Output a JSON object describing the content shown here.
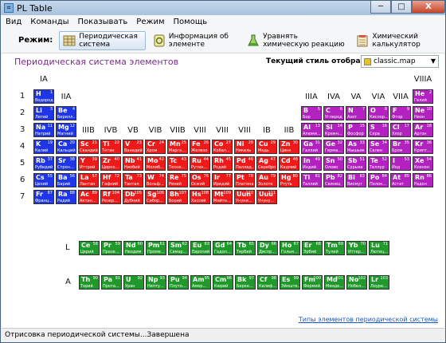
{
  "window": {
    "title": "PL Table",
    "minimize": "─",
    "maximize": "□",
    "close": "X"
  },
  "menu": [
    "Вид",
    "Команды",
    "Показывать",
    "Режим",
    "Помощь"
  ],
  "toolbar": {
    "mode_label": "Режим:",
    "items": [
      {
        "label": "Периодическая система",
        "active": true,
        "icon": "grid-icon"
      },
      {
        "label": "Информация об элементе",
        "active": false,
        "icon": "info-icon"
      },
      {
        "label": "Уравнять химическую реакцию",
        "active": false,
        "icon": "flask-icon"
      },
      {
        "label": "Химический калькулятор",
        "active": false,
        "icon": "calculator-icon"
      }
    ]
  },
  "page_title": "Периодическая система элементов",
  "style": {
    "label": "Текущий стиль отображения:",
    "value": "classic.map"
  },
  "groups": [
    "IA",
    "IIA",
    "IIIB",
    "IVB",
    "VB",
    "VIB",
    "VIIB",
    "VIII",
    "VIII",
    "VIII",
    "IB",
    "IIB",
    "IIIA",
    "IVA",
    "VA",
    "VIA",
    "VIIA",
    "VIIIA"
  ],
  "periods": [
    "1",
    "2",
    "3",
    "4",
    "5",
    "6",
    "7"
  ],
  "series_labels": {
    "lanthanides": "L",
    "actinides": "A"
  },
  "colors": {
    "s": "#1f36e8",
    "transition": "#ee1a1a",
    "p": "#b321c1",
    "f": "#1f9a2a"
  },
  "elements": [
    {
      "s": "H",
      "n": "1",
      "nm": "Водород",
      "p": 1,
      "g": 1,
      "c": "s"
    },
    {
      "s": "He",
      "n": "2",
      "nm": "Гелий",
      "p": 1,
      "g": 18,
      "c": "p"
    },
    {
      "s": "Li",
      "n": "3",
      "nm": "Литий",
      "p": 2,
      "g": 1,
      "c": "s"
    },
    {
      "s": "Be",
      "n": "4",
      "nm": "Берилл...",
      "p": 2,
      "g": 2,
      "c": "s"
    },
    {
      "s": "B",
      "n": "5",
      "nm": "Бор",
      "p": 2,
      "g": 13,
      "c": "p"
    },
    {
      "s": "C",
      "n": "6",
      "nm": "Углерод",
      "p": 2,
      "g": 14,
      "c": "p"
    },
    {
      "s": "N",
      "n": "7",
      "nm": "Азот",
      "p": 2,
      "g": 15,
      "c": "p"
    },
    {
      "s": "O",
      "n": "8",
      "nm": "Кислор...",
      "p": 2,
      "g": 16,
      "c": "p"
    },
    {
      "s": "F",
      "n": "9",
      "nm": "Фтор",
      "p": 2,
      "g": 17,
      "c": "p"
    },
    {
      "s": "Ne",
      "n": "10",
      "nm": "Неон",
      "p": 2,
      "g": 18,
      "c": "p"
    },
    {
      "s": "Na",
      "n": "11",
      "nm": "Натрий",
      "p": 3,
      "g": 1,
      "c": "s"
    },
    {
      "s": "Mg",
      "n": "12",
      "nm": "Магний",
      "p": 3,
      "g": 2,
      "c": "s"
    },
    {
      "s": "Al",
      "n": "13",
      "nm": "Алюми...",
      "p": 3,
      "g": 13,
      "c": "p"
    },
    {
      "s": "Si",
      "n": "14",
      "nm": "Кремн...",
      "p": 3,
      "g": 14,
      "c": "p"
    },
    {
      "s": "P",
      "n": "15",
      "nm": "Фосфор",
      "p": 3,
      "g": 15,
      "c": "p"
    },
    {
      "s": "S",
      "n": "16",
      "nm": "Сера",
      "p": 3,
      "g": 16,
      "c": "p"
    },
    {
      "s": "Cl",
      "n": "17",
      "nm": "Хлор",
      "p": 3,
      "g": 17,
      "c": "p"
    },
    {
      "s": "Ar",
      "n": "18",
      "nm": "Аргон",
      "p": 3,
      "g": 18,
      "c": "p"
    },
    {
      "s": "K",
      "n": "19",
      "nm": "Калий",
      "p": 4,
      "g": 1,
      "c": "s"
    },
    {
      "s": "Ca",
      "n": "20",
      "nm": "Кальций",
      "p": 4,
      "g": 2,
      "c": "s"
    },
    {
      "s": "Sc",
      "n": "21",
      "nm": "Скандий",
      "p": 4,
      "g": 3,
      "c": "t"
    },
    {
      "s": "Ti",
      "n": "22",
      "nm": "Титан",
      "p": 4,
      "g": 4,
      "c": "t"
    },
    {
      "s": "V",
      "n": "23",
      "nm": "Ванадий",
      "p": 4,
      "g": 5,
      "c": "t"
    },
    {
      "s": "Cr",
      "n": "24",
      "nm": "Хром",
      "p": 4,
      "g": 6,
      "c": "t"
    },
    {
      "s": "Mn",
      "n": "25",
      "nm": "Марга...",
      "p": 4,
      "g": 7,
      "c": "t"
    },
    {
      "s": "Fe",
      "n": "26",
      "nm": "Железо",
      "p": 4,
      "g": 8,
      "c": "t"
    },
    {
      "s": "Co",
      "n": "27",
      "nm": "Кобал...",
      "p": 4,
      "g": 9,
      "c": "t"
    },
    {
      "s": "Ni",
      "n": "28",
      "nm": "Никель",
      "p": 4,
      "g": 10,
      "c": "t"
    },
    {
      "s": "Cu",
      "n": "29",
      "nm": "Медь",
      "p": 4,
      "g": 11,
      "c": "t"
    },
    {
      "s": "Zn",
      "n": "30",
      "nm": "Цинк",
      "p": 4,
      "g": 12,
      "c": "t"
    },
    {
      "s": "Ga",
      "n": "31",
      "nm": "Галлий",
      "p": 4,
      "g": 13,
      "c": "p"
    },
    {
      "s": "Ge",
      "n": "32",
      "nm": "Герма...",
      "p": 4,
      "g": 14,
      "c": "p"
    },
    {
      "s": "As",
      "n": "33",
      "nm": "Мышьяк",
      "p": 4,
      "g": 15,
      "c": "p"
    },
    {
      "s": "Se",
      "n": "34",
      "nm": "Селен",
      "p": 4,
      "g": 16,
      "c": "p"
    },
    {
      "s": "Br",
      "n": "35",
      "nm": "Бром",
      "p": 4,
      "g": 17,
      "c": "p"
    },
    {
      "s": "Kr",
      "n": "36",
      "nm": "Крипт...",
      "p": 4,
      "g": 18,
      "c": "p"
    },
    {
      "s": "Rb",
      "n": "37",
      "nm": "Рубидий",
      "p": 5,
      "g": 1,
      "c": "s"
    },
    {
      "s": "Sr",
      "n": "38",
      "nm": "Строн...",
      "p": 5,
      "g": 2,
      "c": "s"
    },
    {
      "s": "Y",
      "n": "39",
      "nm": "Иттрий",
      "p": 5,
      "g": 3,
      "c": "t"
    },
    {
      "s": "Zr",
      "n": "40",
      "nm": "Цирко...",
      "p": 5,
      "g": 4,
      "c": "t"
    },
    {
      "s": "Nb",
      "n": "41",
      "nm": "Ниобий",
      "p": 5,
      "g": 5,
      "c": "t"
    },
    {
      "s": "Mo",
      "n": "42",
      "nm": "Молиб...",
      "p": 5,
      "g": 6,
      "c": "t"
    },
    {
      "s": "Tc",
      "n": "43",
      "nm": "Техне...",
      "p": 5,
      "g": 7,
      "c": "t"
    },
    {
      "s": "Ru",
      "n": "44",
      "nm": "Рутен...",
      "p": 5,
      "g": 8,
      "c": "t"
    },
    {
      "s": "Rh",
      "n": "45",
      "nm": "Родий",
      "p": 5,
      "g": 9,
      "c": "t"
    },
    {
      "s": "Pd",
      "n": "46",
      "nm": "Паллад...",
      "p": 5,
      "g": 10,
      "c": "t"
    },
    {
      "s": "Ag",
      "n": "47",
      "nm": "Серебро",
      "p": 5,
      "g": 11,
      "c": "t"
    },
    {
      "s": "Cd",
      "n": "48",
      "nm": "Кадмий",
      "p": 5,
      "g": 12,
      "c": "t"
    },
    {
      "s": "In",
      "n": "49",
      "nm": "Индий",
      "p": 5,
      "g": 13,
      "c": "p"
    },
    {
      "s": "Sn",
      "n": "50",
      "nm": "Олово",
      "p": 5,
      "g": 14,
      "c": "p"
    },
    {
      "s": "Sb",
      "n": "51",
      "nm": "Сурьма",
      "p": 5,
      "g": 15,
      "c": "p"
    },
    {
      "s": "Te",
      "n": "52",
      "nm": "Теллур",
      "p": 5,
      "g": 16,
      "c": "p"
    },
    {
      "s": "I",
      "n": "53",
      "nm": "Йод",
      "p": 5,
      "g": 17,
      "c": "p"
    },
    {
      "s": "Xe",
      "n": "54",
      "nm": "Ксенон",
      "p": 5,
      "g": 18,
      "c": "p"
    },
    {
      "s": "Cs",
      "n": "55",
      "nm": "Цезий",
      "p": 6,
      "g": 1,
      "c": "s"
    },
    {
      "s": "Ba",
      "n": "56",
      "nm": "Барий",
      "p": 6,
      "g": 2,
      "c": "s"
    },
    {
      "s": "La",
      "n": "57",
      "nm": "Лантан",
      "p": 6,
      "g": 3,
      "c": "t"
    },
    {
      "s": "Hf",
      "n": "72",
      "nm": "Гафний",
      "p": 6,
      "g": 4,
      "c": "t"
    },
    {
      "s": "Ta",
      "n": "73",
      "nm": "Тантал",
      "p": 6,
      "g": 5,
      "c": "t"
    },
    {
      "s": "W",
      "n": "74",
      "nm": "Вольф...",
      "p": 6,
      "g": 6,
      "c": "t"
    },
    {
      "s": "Re",
      "n": "75",
      "nm": "Рений",
      "p": 6,
      "g": 7,
      "c": "t"
    },
    {
      "s": "Os",
      "n": "76",
      "nm": "Осмий",
      "p": 6,
      "g": 8,
      "c": "t"
    },
    {
      "s": "Ir",
      "n": "77",
      "nm": "Иридий",
      "p": 6,
      "g": 9,
      "c": "t"
    },
    {
      "s": "Pt",
      "n": "78",
      "nm": "Платина",
      "p": 6,
      "g": 10,
      "c": "t"
    },
    {
      "s": "Au",
      "n": "79",
      "nm": "Золото",
      "p": 6,
      "g": 11,
      "c": "t"
    },
    {
      "s": "Hg",
      "n": "80",
      "nm": "Ртуть",
      "p": 6,
      "g": 12,
      "c": "t"
    },
    {
      "s": "Tl",
      "n": "81",
      "nm": "Таллий",
      "p": 6,
      "g": 13,
      "c": "p"
    },
    {
      "s": "Pb",
      "n": "82",
      "nm": "Свинец",
      "p": 6,
      "g": 14,
      "c": "p"
    },
    {
      "s": "Bi",
      "n": "83",
      "nm": "Висмут",
      "p": 6,
      "g": 15,
      "c": "p"
    },
    {
      "s": "Po",
      "n": "84",
      "nm": "Полон...",
      "p": 6,
      "g": 16,
      "c": "p"
    },
    {
      "s": "At",
      "n": "85",
      "nm": "Астат",
      "p": 6,
      "g": 17,
      "c": "p"
    },
    {
      "s": "Rn",
      "n": "86",
      "nm": "Радон",
      "p": 6,
      "g": 18,
      "c": "p"
    },
    {
      "s": "Fr",
      "n": "87",
      "nm": "Франц...",
      "p": 7,
      "g": 1,
      "c": "s"
    },
    {
      "s": "Ra",
      "n": "88",
      "nm": "Радий",
      "p": 7,
      "g": 2,
      "c": "s"
    },
    {
      "s": "Ac",
      "n": "89",
      "nm": "Актин...",
      "p": 7,
      "g": 3,
      "c": "t"
    },
    {
      "s": "Rf",
      "n": "104",
      "nm": "Резер...",
      "p": 7,
      "g": 4,
      "c": "t"
    },
    {
      "s": "Db",
      "n": "105",
      "nm": "Дубний",
      "p": 7,
      "g": 5,
      "c": "t"
    },
    {
      "s": "Sg",
      "n": "106",
      "nm": "Сибор...",
      "p": 7,
      "g": 6,
      "c": "t"
    },
    {
      "s": "Bh",
      "n": "107",
      "nm": "Борий",
      "p": 7,
      "g": 7,
      "c": "t"
    },
    {
      "s": "Hs",
      "n": "108",
      "nm": "Хассий",
      "p": 7,
      "g": 8,
      "c": "t"
    },
    {
      "s": "Mt",
      "n": "109",
      "nm": "Мейтн...",
      "p": 7,
      "g": 9,
      "c": "t"
    },
    {
      "s": "Uun",
      "n": "110",
      "nm": "Унуни...",
      "p": 7,
      "g": 10,
      "c": "t"
    },
    {
      "s": "Uuu",
      "n": "111",
      "nm": "Унуну...",
      "p": 7,
      "g": 11,
      "c": "t"
    }
  ],
  "lanthanides": [
    {
      "s": "Ce",
      "n": "58",
      "nm": "Церий"
    },
    {
      "s": "Pr",
      "n": "59",
      "nm": "Празе..."
    },
    {
      "s": "Nd",
      "n": "60",
      "nm": "Неодим"
    },
    {
      "s": "Pm",
      "n": "61",
      "nm": "Проме..."
    },
    {
      "s": "Sm",
      "n": "62",
      "nm": "Самар..."
    },
    {
      "s": "Eu",
      "n": "63",
      "nm": "Европий"
    },
    {
      "s": "Gd",
      "n": "64",
      "nm": "Гадол..."
    },
    {
      "s": "Tb",
      "n": "65",
      "nm": "Тербий"
    },
    {
      "s": "Dy",
      "n": "66",
      "nm": "Диспр..."
    },
    {
      "s": "Ho",
      "n": "67",
      "nm": "Гольм..."
    },
    {
      "s": "Er",
      "n": "68",
      "nm": "Эрбий"
    },
    {
      "s": "Tm",
      "n": "69",
      "nm": "Тулий"
    },
    {
      "s": "Yb",
      "n": "70",
      "nm": "Иттер..."
    },
    {
      "s": "Lu",
      "n": "71",
      "nm": "Лютец..."
    }
  ],
  "actinides": [
    {
      "s": "Th",
      "n": "90",
      "nm": "Торий"
    },
    {
      "s": "Pa",
      "n": "91",
      "nm": "Прота..."
    },
    {
      "s": "U",
      "n": "92",
      "nm": "Уран"
    },
    {
      "s": "Np",
      "n": "93",
      "nm": "Непту..."
    },
    {
      "s": "Pu",
      "n": "94",
      "nm": "Плуто..."
    },
    {
      "s": "Am",
      "n": "95",
      "nm": "Амер..."
    },
    {
      "s": "Cm",
      "n": "96",
      "nm": "Кюрий"
    },
    {
      "s": "Bk",
      "n": "97",
      "nm": "Берке..."
    },
    {
      "s": "Cf",
      "n": "98",
      "nm": "Калиф..."
    },
    {
      "s": "Es",
      "n": "99",
      "nm": "Эйнште..."
    },
    {
      "s": "Fm",
      "n": "100",
      "nm": "Фермий"
    },
    {
      "s": "Md",
      "n": "101",
      "nm": "Менде..."
    },
    {
      "s": "No",
      "n": "102",
      "nm": "Нобел..."
    },
    {
      "s": "Lr",
      "n": "103",
      "nm": "Лоуре..."
    }
  ],
  "footer_link": "Типы элементов периодической системы",
  "status": "Отрисовка периодической системы...Завершена"
}
